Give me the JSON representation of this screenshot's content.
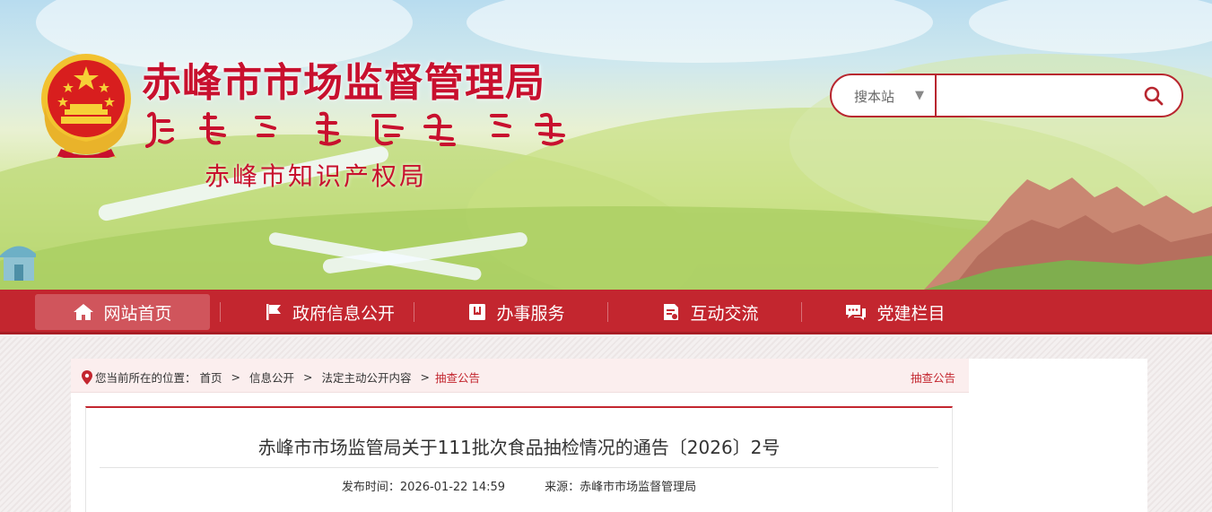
{
  "header": {
    "site_title": "赤峰市市场监督管理局",
    "sub_title": "赤峰市知识产权局",
    "search": {
      "scope_label": "搜本站",
      "input_value": "",
      "placeholder": ""
    }
  },
  "nav": {
    "items": [
      {
        "label": "网站首页",
        "icon": "home-icon",
        "active": true
      },
      {
        "label": "政府信息公开",
        "icon": "flag-icon"
      },
      {
        "label": "办事服务",
        "icon": "book-icon"
      },
      {
        "label": "互动交流",
        "icon": "document-icon"
      },
      {
        "label": "党建栏目",
        "icon": "chat-icon"
      }
    ]
  },
  "breadcrumb": {
    "prefix": "您当前所在的位置：",
    "items": [
      "首页",
      "信息公开",
      "法定主动公开内容",
      "抽查公告"
    ],
    "separator": ">",
    "section": "抽查公告"
  },
  "article": {
    "title": "赤峰市市场监管局关于111批次食品抽检情况的通告〔2026〕2号",
    "publish_label": "发布时间：2026-01-22 14:59",
    "source_label": "来源：赤峰市市场监督管理局"
  },
  "colors": {
    "brand_red": "#c3262f",
    "title_red": "#c8102e",
    "emblem_gold": "#f2c230"
  }
}
